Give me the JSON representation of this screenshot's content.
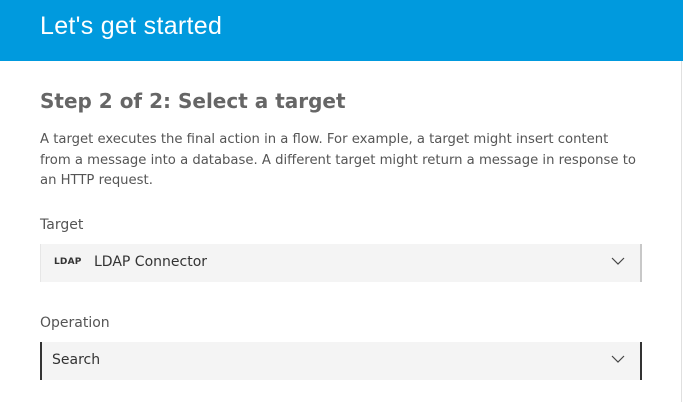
{
  "header": {
    "title": "Let's get started"
  },
  "step": {
    "title": "Step 2 of 2: Select a target",
    "description": "A target executes the final action in a flow. For example, a target might insert content from a message into a database. A different target might return a message in response to an HTTP request."
  },
  "target_field": {
    "label": "Target",
    "badge": "LDAP",
    "value": "LDAP Connector",
    "icon": "chevron-down-icon"
  },
  "operation_field": {
    "label": "Operation",
    "value": "Search",
    "icon": "chevron-down-icon"
  },
  "colors": {
    "header_bg": "#009ade",
    "header_text": "#ffffff",
    "select_bg": "#f4f4f4",
    "focus_border": "#333333"
  }
}
